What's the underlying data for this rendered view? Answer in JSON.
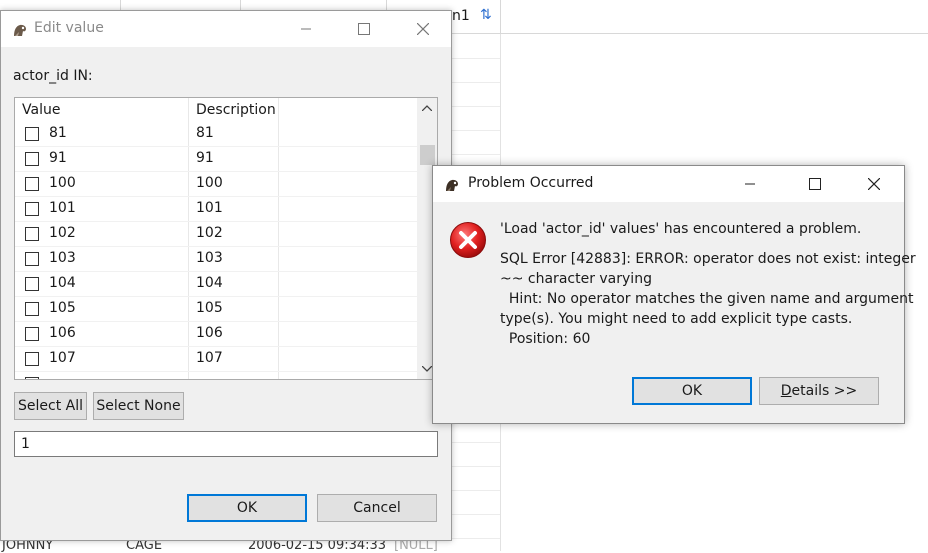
{
  "background": {
    "column_header": "n1",
    "bottom_row": {
      "first_name": "JOHNNY",
      "last_name": "CAGE",
      "last_update": "2006-02-15 09:34:33",
      "extra": "[NULL]"
    }
  },
  "edit_dialog": {
    "title": "Edit value",
    "label": "actor_id IN:",
    "columns": {
      "value": "Value",
      "description": "Description"
    },
    "rows": [
      {
        "value": "81",
        "description": "81"
      },
      {
        "value": "91",
        "description": "91"
      },
      {
        "value": "100",
        "description": "100"
      },
      {
        "value": "101",
        "description": "101"
      },
      {
        "value": "102",
        "description": "102"
      },
      {
        "value": "103",
        "description": "103"
      },
      {
        "value": "104",
        "description": "104"
      },
      {
        "value": "105",
        "description": "105"
      },
      {
        "value": "106",
        "description": "106"
      },
      {
        "value": "107",
        "description": "107"
      }
    ],
    "select_all_label": "Select All",
    "select_none_label": "Select None",
    "input_value": "1",
    "ok_label": "OK",
    "cancel_label": "Cancel"
  },
  "problem_dialog": {
    "title": "Problem Occurred",
    "summary": "'Load 'actor_id' values' has encountered a problem.",
    "details_lines": [
      "SQL Error [42883]: ERROR: operator does not exist: integer",
      "~~ character varying",
      "  Hint: No operator matches the given name and argument",
      "type(s). You might need to add explicit type casts.",
      "  Position: 60"
    ],
    "ok_label": "OK",
    "details_button_label": "etails >>",
    "details_button_accel": "D"
  },
  "colors": {
    "accent": "#0078d7",
    "error": "#e81123"
  }
}
